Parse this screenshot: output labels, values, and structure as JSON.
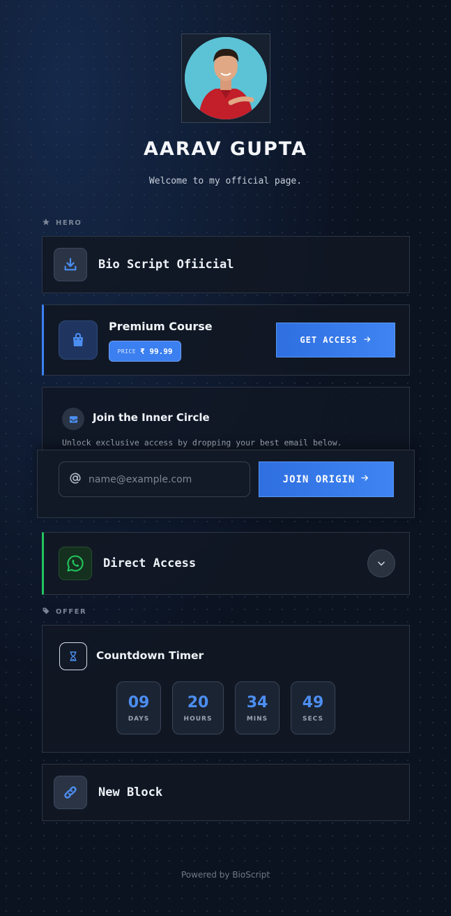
{
  "profile": {
    "name": "AARAV GUPTA",
    "tagline": "Welcome to my official page."
  },
  "sections": {
    "hero_label": "HERO",
    "offer_label": "OFFER"
  },
  "bio_block": {
    "title": "Bio Script Ofiicial",
    "icon": "download-icon"
  },
  "course": {
    "title": "Premium Course",
    "price_label": "PRICE",
    "price_value": "₹ 99.99",
    "cta": "GET ACCESS",
    "icon": "shopping-bag-icon"
  },
  "newsletter": {
    "title": "Join the Inner Circle",
    "description": "Unlock exclusive access by dropping your best email below.",
    "email_placeholder": "name@example.com",
    "cta": "JOIN ORIGIN",
    "icon": "inbox-icon"
  },
  "whatsapp": {
    "title": "Direct Access",
    "icon": "whatsapp-icon"
  },
  "countdown": {
    "title": "Countdown Timer",
    "units": [
      {
        "value": "09",
        "label": "DAYS"
      },
      {
        "value": "20",
        "label": "HOURS"
      },
      {
        "value": "34",
        "label": "MINS"
      },
      {
        "value": "49",
        "label": "SECS"
      }
    ]
  },
  "new_block": {
    "title": "New Block",
    "icon": "link-icon"
  },
  "footer": {
    "text": "Powered by BioScript"
  },
  "colors": {
    "accent": "#3b82f6",
    "whatsapp": "#22c55e",
    "background": "#0b1220"
  }
}
